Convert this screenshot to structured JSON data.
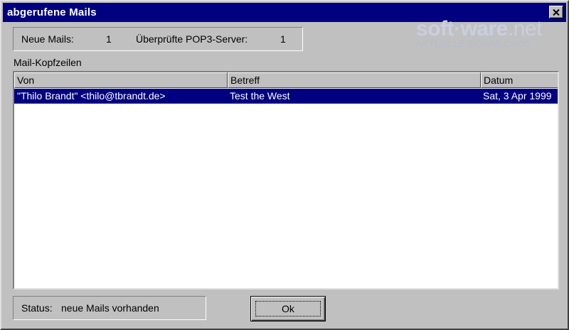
{
  "window": {
    "title": "abgerufene Mails",
    "close_icon": "close-icon"
  },
  "summary": {
    "new_mails_label": "Neue Mails:",
    "new_mails_count": "1",
    "servers_label": "Überprüfte POP3-Server:",
    "servers_count": "1"
  },
  "watermark": {
    "brand": "soft·ware",
    "tld": ".net",
    "tagline": "AKTUELLE DOWNLOADS"
  },
  "headers_section": {
    "label": "Mail-Kopfzeilen",
    "columns": [
      "Von",
      "Betreff",
      "Datum"
    ],
    "rows": [
      {
        "from": "\"Thilo Brandt\" <thilo@tbrandt.de>",
        "subject": "Test the West",
        "date": "Sat, 3 Apr 1999",
        "selected": true
      }
    ]
  },
  "status": {
    "label": "Status:",
    "value": "neue Mails vorhanden"
  },
  "buttons": {
    "ok_label": "Ok"
  },
  "colors": {
    "titlebar": "#000080",
    "selection": "#000080",
    "face": "#c0c0c0",
    "watermark_dot": "#cc2222"
  }
}
